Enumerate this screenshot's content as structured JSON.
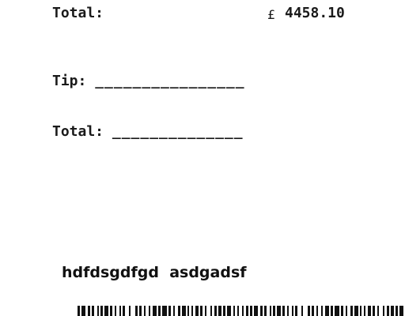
{
  "receipt": {
    "total_label": "Total:",
    "currency_symbol": "£",
    "total_amount": "4458.10",
    "tip_label": "Tip:",
    "tip_line": "________________",
    "total_line_label": "Total:",
    "total_line": "______________"
  },
  "footer": {
    "text": "hdfdsgdfgd  asdgadsf"
  },
  "barcode": {
    "icon": "barcode-icon",
    "color": "#111111"
  }
}
